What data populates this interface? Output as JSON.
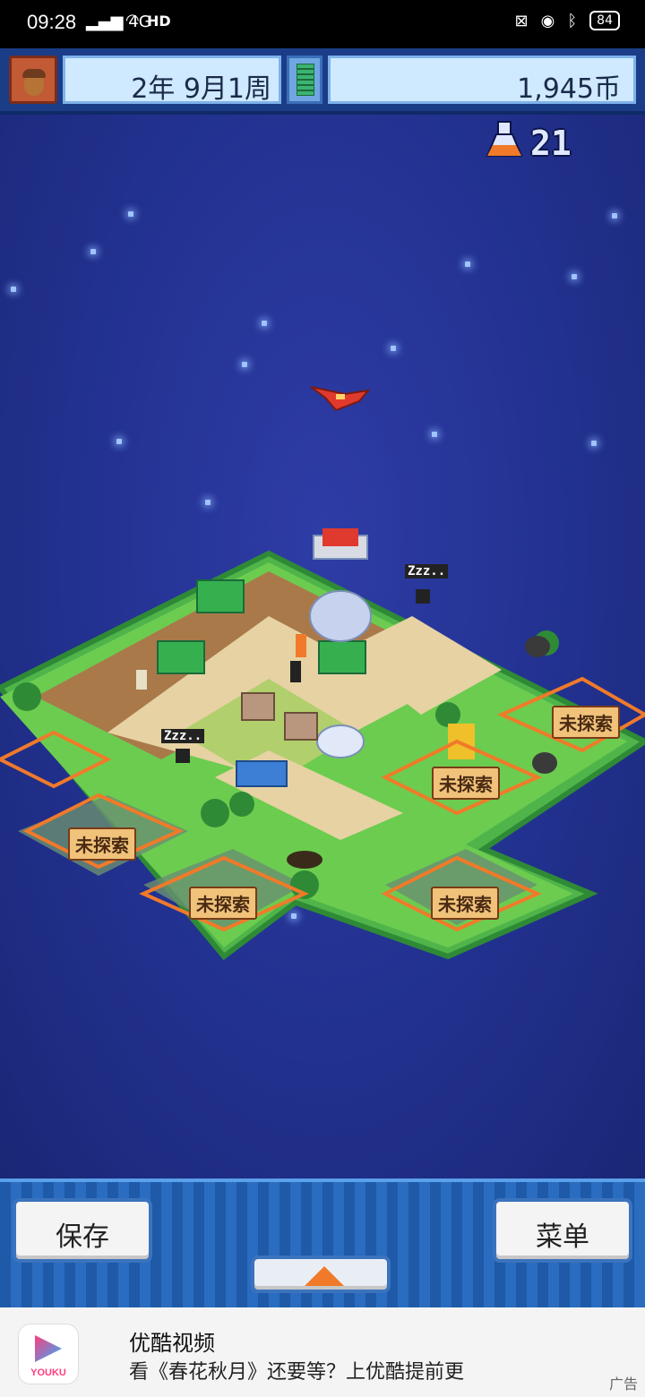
{
  "status_bar": {
    "time": "09:28",
    "network": "4G",
    "hd": "HD",
    "battery": "84"
  },
  "top_bar": {
    "date": "2年 9月1周",
    "money": "1,945币"
  },
  "research": {
    "value": "21"
  },
  "map": {
    "unexplored_label": "未探索",
    "sleep_label": "Zzz.."
  },
  "controls": {
    "save_label": "保存",
    "menu_label": "菜单"
  },
  "ad": {
    "brand": "YOUKU",
    "title": "优酷视频",
    "description": "看《春花秋月》还要等？上优酷提前更",
    "tag": "广告"
  }
}
